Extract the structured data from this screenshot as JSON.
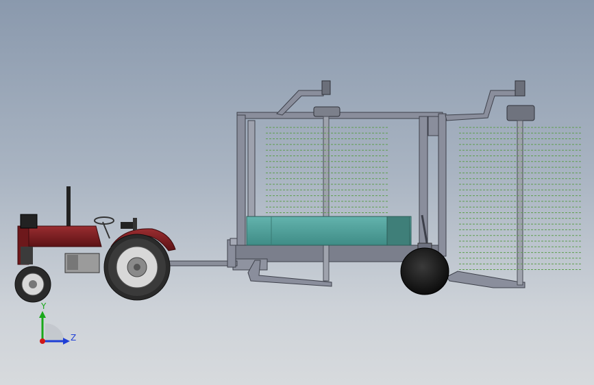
{
  "triad": {
    "y_label": "Y",
    "z_label": "Z",
    "y_color": "#1aa81a",
    "z_color": "#1f3fd6",
    "origin_color": "#d01818"
  },
  "colors": {
    "tractor_body": "#7a1e22",
    "tank": "#4f9f9a",
    "frame": "#7d8190",
    "sprinkler_line": "#5e9e4e"
  }
}
